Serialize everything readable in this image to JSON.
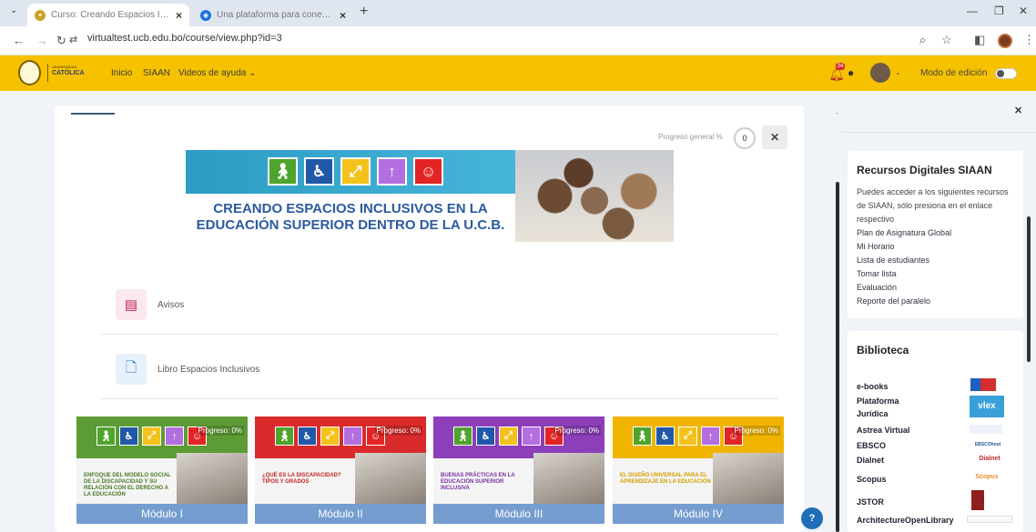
{
  "browser": {
    "tabs": [
      {
        "title": "Curso: Creando Espacios Inclus",
        "active": true
      },
      {
        "title": "Una plataforma para conectar",
        "active": false
      }
    ],
    "url": "virtualtest.ucb.edu.bo/course/view.php?id=3"
  },
  "sitenav": {
    "logo_text": "CATÓLICA",
    "links": [
      "Inicio",
      "SIAAN",
      "Videos de ayuda"
    ],
    "notification_count": "34",
    "edit_mode_label": "Modo de edición"
  },
  "course": {
    "progress_label": "Progreso general %",
    "progress_value": "0",
    "banner_title_line1": "CREANDO ESPACIOS INCLUSIVOS EN LA",
    "banner_title_line2": "EDUCACIÓN SUPERIOR DENTRO DE LA U.C.B.",
    "activities": [
      {
        "label": "Avisos"
      },
      {
        "label": "Libro Espacios Inclusivos"
      }
    ],
    "modules": [
      {
        "label": "Módulo I",
        "progress": "Progreso: 0%",
        "color": "#5d9c34",
        "text": "ENFOQUE DEL MODELO SOCIAL DE LA DISCAPACIDAD Y SU RELACIÓN CON EL DERECHO A LA EDUCACIÓN",
        "text_color": "#4a7a23"
      },
      {
        "label": "Módulo II",
        "progress": "Progreso: 0%",
        "color": "#d92b2b",
        "text": "¿QUÉ ES LA DISCAPACIDAD? TIPOS Y GRADOS",
        "text_color": "#c42222"
      },
      {
        "label": "Módulo III",
        "progress": "Progreso: 0%",
        "color": "#8c3fb8",
        "text": "BUENAS PRÁCTICAS EN LA EDUCACIÓN SUPERIOR INCLUSIVA",
        "text_color": "#7a2fa3"
      },
      {
        "label": "Módulo IV",
        "progress": "Progreso: 0%",
        "color": "#f0b400",
        "text": "EL DISEÑO UNIVERSAL PARA EL APRENDIZAJE EN LA EDUCACIÓN",
        "text_color": "#d4a000"
      }
    ]
  },
  "drawer": {
    "siaan": {
      "title": "Recursos Digitales SIAAN",
      "description": "Puedes acceder a los siguientes recursos de SIAAN, sólo presiona en el enlace respectivo",
      "links": [
        "Plan de Asignatura Global",
        "Mi Horario",
        "Lista de estudiantes",
        "Tomar lista",
        "Evaluación",
        "Reporte del paralelo"
      ]
    },
    "biblioteca": {
      "title": "Biblioteca",
      "items": [
        "e-books",
        "Plataforma Jurídica",
        "Astrea Virtual",
        "EBSCO",
        "Dialnet",
        "Scopus",
        "JSTOR",
        "ArchitectureOpenLibrary"
      ],
      "logos": {
        "vlex": "vlex",
        "dialnet": "Dialnet",
        "scopus": "Scopus",
        "ebsco": "EBSCOhost"
      }
    }
  },
  "colors": {
    "nav_yellow": "#f6c200",
    "banner_blue": "#2a5aa0"
  }
}
